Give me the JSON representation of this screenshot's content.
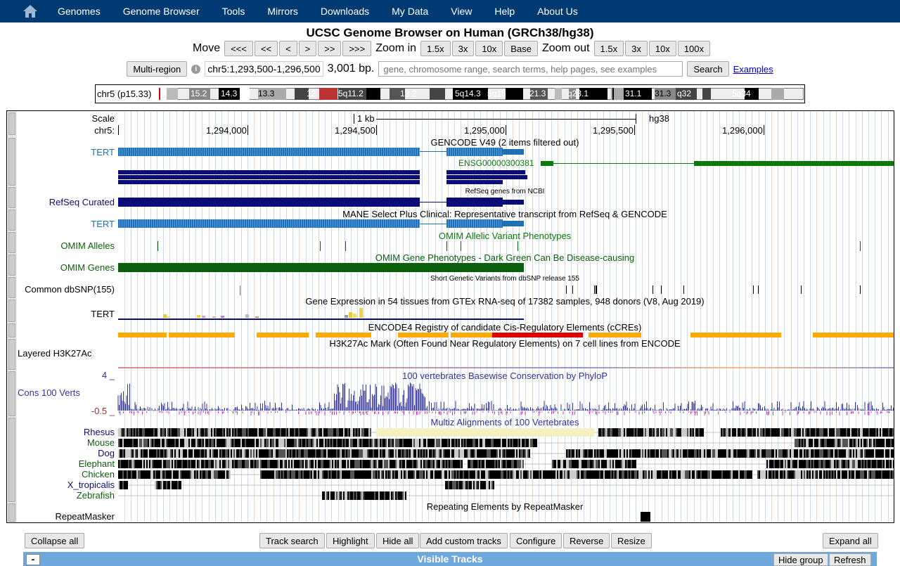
{
  "nav": [
    "Genomes",
    "Genome Browser",
    "Tools",
    "Mirrors",
    "Downloads",
    "My Data",
    "View",
    "Help",
    "About Us"
  ],
  "title": "UCSC Genome Browser on Human (GRCh38/hg38)",
  "move": {
    "label": "Move",
    "buttons": [
      "<<<",
      "<<",
      "<",
      ">",
      ">>",
      ">>>"
    ]
  },
  "zoom_in": {
    "label": "Zoom in",
    "buttons": [
      "1.5x",
      "3x",
      "10x",
      "Base"
    ]
  },
  "zoom_out": {
    "label": "Zoom out",
    "buttons": [
      "1.5x",
      "3x",
      "10x",
      "100x"
    ]
  },
  "multi_region": "Multi-region",
  "position": "chr5:1,293,500-1,296,500",
  "size": "3,001 bp.",
  "search_placeholder": "gene, chromosome range, search terms, help pages, see examples",
  "search_button": "Search",
  "examples_link": "Examples",
  "ideogram": {
    "label": "chr5 (p15.33)",
    "bands": [
      "15.2",
      "14.3",
      "13.3",
      "12",
      "5q11.2",
      "13.2",
      "5q14.3",
      "5q15",
      "21.3",
      "q23.1",
      "23.2",
      "31.1",
      "31.3",
      "q32",
      "5q34"
    ]
  },
  "scale": {
    "label": "Scale",
    "chr_label": "chr5:",
    "bar": "1 kb",
    "assembly": "hg38",
    "ticks": [
      "1,294,000",
      "1,294,500",
      "1,295,000",
      "1,295,500",
      "1,296,000"
    ]
  },
  "tracks": {
    "gencode": {
      "caption": "GENCODE V49 (2 items filtered out)",
      "label": "TERT",
      "item2": "ENSG00000300381"
    },
    "refseq": {
      "caption": "RefSeq genes from NCBI",
      "label": "RefSeq Curated"
    },
    "mane": {
      "caption": "MANE Select Plus Clinical: Representative transcript from RefSeq & GENCODE",
      "label": "TERT"
    },
    "omim_alleles": {
      "caption": "OMIM Allelic Variant Phenotypes",
      "label": "OMIM Alleles"
    },
    "omim_genes": {
      "caption": "OMIM Gene Phenotypes - Dark Green Can Be Disease-causing",
      "label": "OMIM Genes"
    },
    "dbsnp": {
      "caption": "Short Genetic Variants from dbSNP release 155",
      "label": "Common dbSNP(155)"
    },
    "gtex": {
      "caption": "Gene Expression in 54 tissues from GTEx RNA-seq of 17382 samples, 948 donors (V8, Aug 2019)",
      "label": "TERT"
    },
    "encode": {
      "caption": "ENCODE4 Registry of candidate Cis-Regulatory Elements (cCREs)"
    },
    "h3k27ac": {
      "caption": "H3K27Ac Mark (Often Found Near Regulatory Elements) on 7 cell lines from ENCODE",
      "label": "Layered H3K27Ac"
    },
    "phylop": {
      "caption": "100 vertebrates Basewise Conservation by PhyloP",
      "label": "Cons 100 Verts",
      "ymax": "4 _",
      "ymin": "-0.5 _"
    },
    "multiz": {
      "caption": "Multiz Alignments of 100 Vertebrates",
      "species": [
        "Rhesus",
        "Mouse",
        "Dog",
        "Elephant",
        "Chicken",
        "X_tropicalis",
        "Zebrafish"
      ]
    },
    "rmsk": {
      "caption": "Repeating Elements by RepeatMasker",
      "label": "RepeatMasker"
    }
  },
  "colors": {
    "nav": "#003a72",
    "gene": "#1f6fb5",
    "refseq": "#0c0c78",
    "omim": "#0b5e0b",
    "encode": "#ffaa00",
    "promoter": "#dd0000"
  },
  "buttons": {
    "collapse_all": "Collapse all",
    "track_search": "Track search",
    "highlight": "Highlight",
    "hide_all": "Hide all",
    "add_custom": "Add custom tracks",
    "configure": "Configure",
    "reverse": "Reverse",
    "resize": "Resize",
    "expand_all": "Expand all",
    "hide_group": "Hide group",
    "refresh": "Refresh"
  },
  "visible_tracks": "Visible Tracks",
  "collapse_symbol": "-"
}
